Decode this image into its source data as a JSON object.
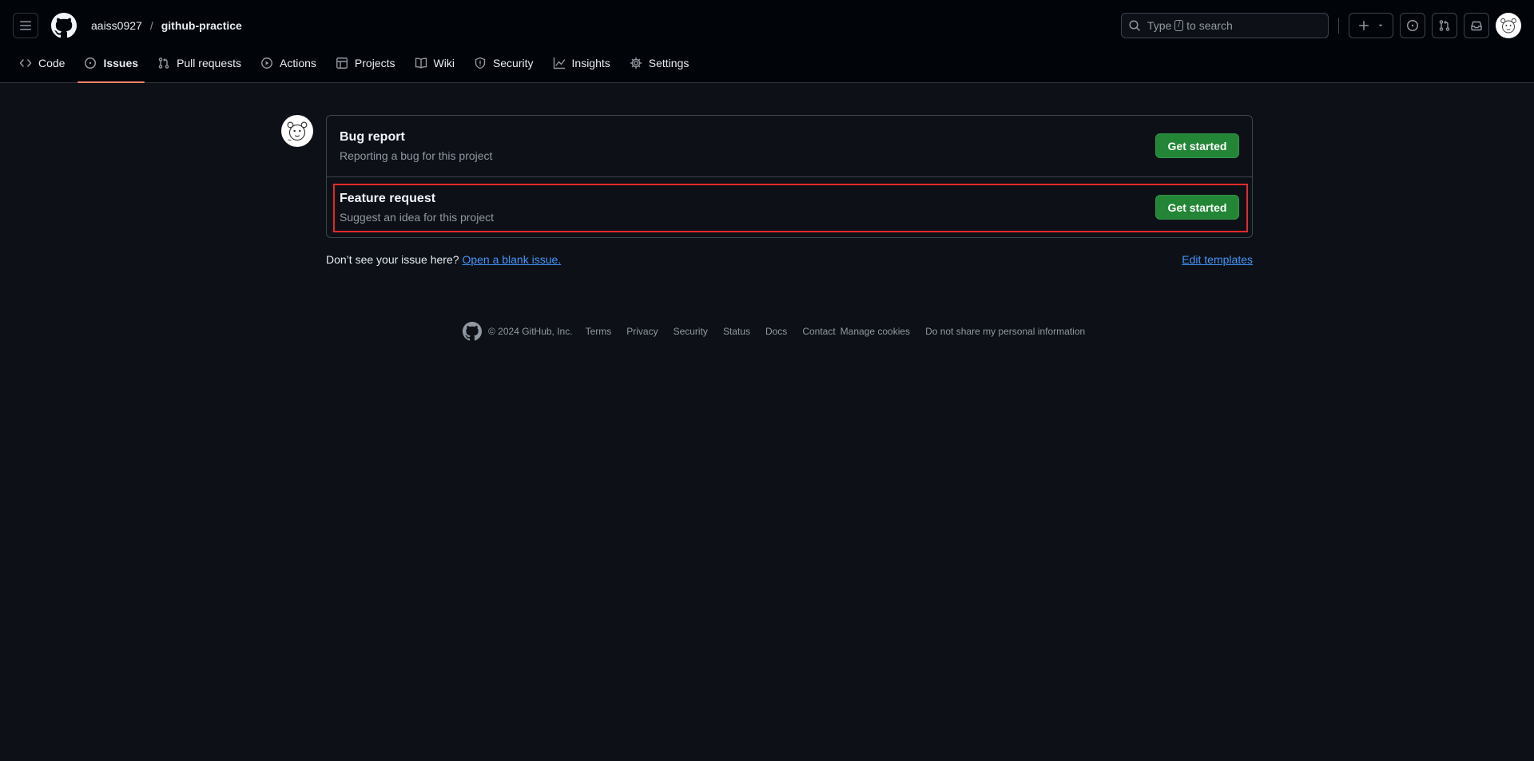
{
  "header": {
    "owner": "aaiss0927",
    "separator": "/",
    "repo": "github-practice",
    "search": {
      "prefix": "Type",
      "key": "/",
      "suffix": "to search"
    }
  },
  "tabs": [
    {
      "label": "Code",
      "icon": "code-icon"
    },
    {
      "label": "Issues",
      "icon": "issue-opened-icon"
    },
    {
      "label": "Pull requests",
      "icon": "git-pull-request-icon"
    },
    {
      "label": "Actions",
      "icon": "play-icon"
    },
    {
      "label": "Projects",
      "icon": "table-icon"
    },
    {
      "label": "Wiki",
      "icon": "book-icon"
    },
    {
      "label": "Security",
      "icon": "shield-icon"
    },
    {
      "label": "Insights",
      "icon": "graph-icon"
    },
    {
      "label": "Settings",
      "icon": "gear-icon"
    }
  ],
  "templates": [
    {
      "title": "Bug report",
      "description": "Reporting a bug for this project",
      "button": "Get started"
    },
    {
      "title": "Feature request",
      "description": "Suggest an idea for this project",
      "button": "Get started"
    }
  ],
  "blank_issue": {
    "question": "Don’t see your issue here?",
    "link": "Open a blank issue.",
    "edit": "Edit templates"
  },
  "footer": {
    "copyright": "© 2024 GitHub, Inc.",
    "links": [
      "Terms",
      "Privacy",
      "Security",
      "Status",
      "Docs",
      "Contact",
      "Manage cookies",
      "Do not share my personal information"
    ]
  },
  "colors": {
    "background": "#0d1117",
    "header": "#010409",
    "accent_tab": "#f78166",
    "button_green": "#238636",
    "link_blue": "#4493f8",
    "highlight_red": "#e5292b"
  }
}
